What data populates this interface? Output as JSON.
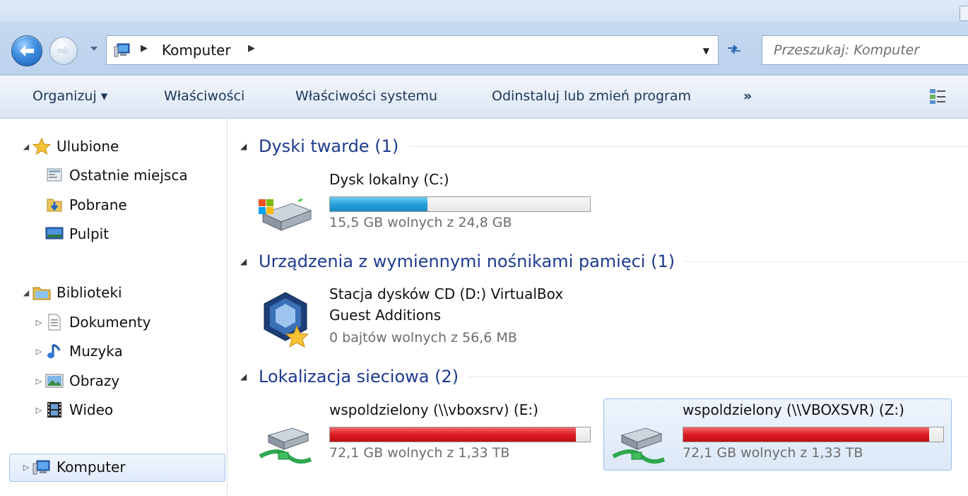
{
  "address": {
    "location": "Komputer",
    "search_placeholder": "Przeszukaj: Komputer"
  },
  "toolbar": {
    "organize": "Organizuj ▾",
    "properties": "Właściwości",
    "system_properties": "Właściwości systemu",
    "uninstall": "Odinstaluj lub zmień program",
    "more": "»"
  },
  "nav": {
    "favorites": {
      "label": "Ulubione",
      "items": [
        "Ostatnie miejsca",
        "Pobrane",
        "Pulpit"
      ]
    },
    "libraries": {
      "label": "Biblioteki",
      "items": [
        "Dokumenty",
        "Muzyka",
        "Obrazy",
        "Wideo"
      ]
    },
    "computer": "Komputer"
  },
  "groups": {
    "hard_disks": {
      "title": "Dyski twarde (1)",
      "drives": [
        {
          "name": "Dysk lokalny (C:)",
          "free_text": "15,5 GB wolnych z 24,8 GB",
          "used_fraction": 0.375,
          "bar_color": "#26a0da"
        }
      ]
    },
    "removable": {
      "title": "Urządzenia z wymiennymi nośnikami pamięci (1)",
      "drives": [
        {
          "name_line1": "Stacja dysków CD (D:) VirtualBox",
          "name_line2": "Guest Additions",
          "free_text": "0 bajtów wolnych z 56,6 MB"
        }
      ]
    },
    "network": {
      "title": "Lokalizacja sieciowa (2)",
      "drives": [
        {
          "name": "wspoldzielony (\\\\vboxsrv) (E:)",
          "free_text": "72,1 GB wolnych z 1,33 TB",
          "used_fraction": 0.947,
          "bar_color": "#da1c22"
        },
        {
          "name": "wspoldzielony (\\\\VBOXSVR) (Z:)",
          "free_text": "72,1 GB wolnych z 1,33 TB",
          "used_fraction": 0.947,
          "bar_color": "#da1c22"
        }
      ]
    }
  },
  "colors": {
    "group_title": "#1e3b8f",
    "toolbar_text": "#1d3557",
    "selection_border": "#9cbde8"
  }
}
